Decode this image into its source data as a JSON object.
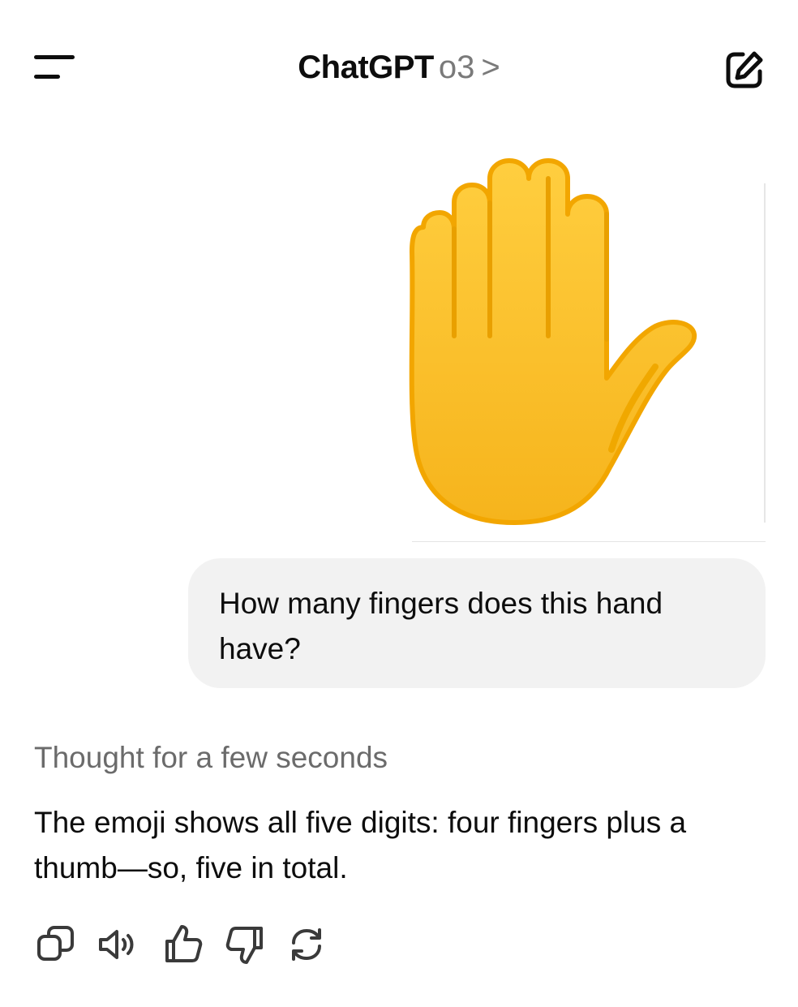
{
  "header": {
    "app_name": "ChatGPT",
    "model": "o3",
    "chevron": ">",
    "menu_icon": "menu-icon",
    "edit_icon": "new-chat-icon"
  },
  "attachment": {
    "type": "image",
    "depicts": "raised-hand-emoji"
  },
  "user_message": {
    "text": "How many fingers does this hand have?"
  },
  "assistant": {
    "thought_label": "Thought for a few seconds",
    "answer": "The emoji shows all five digits: four fingers plus a thumb—so, five in total."
  },
  "actions": [
    {
      "icon": "copy-icon"
    },
    {
      "icon": "read-aloud-icon"
    },
    {
      "icon": "thumbs-up-icon"
    },
    {
      "icon": "thumbs-down-icon"
    },
    {
      "icon": "regenerate-icon"
    }
  ],
  "colors": {
    "hand_fill": "#FFC83D",
    "hand_shade": "#F2A600",
    "bubble": "#F2F2F2",
    "muted_text": "#6B6B6B"
  }
}
